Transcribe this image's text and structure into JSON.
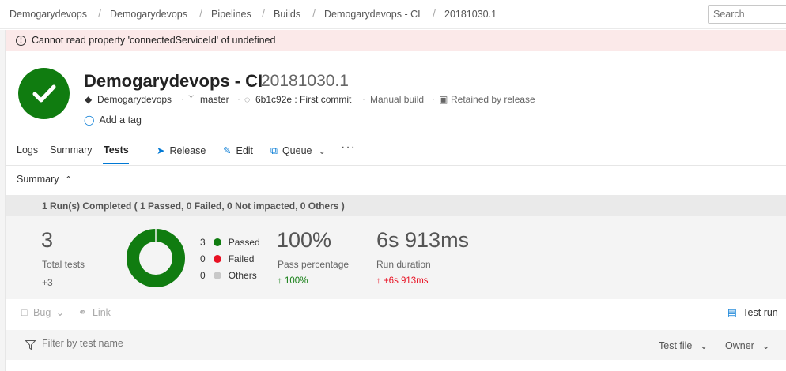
{
  "breadcrumb": [
    "Demogarydevops",
    "Demogarydevops",
    "Pipelines",
    "Builds",
    "Demogarydevops - CI",
    "20181030.1"
  ],
  "search": {
    "placeholder": "Search"
  },
  "error": {
    "message": "Cannot read property 'connectedServiceId' of undefined"
  },
  "build": {
    "title": "Demogarydevops - CI",
    "number": "20181030.1",
    "status": "succeeded",
    "status_color": "#107c10",
    "repo": "Demogarydevops",
    "branch": "master",
    "commit": "6b1c92e : First commit",
    "trigger": "Manual build",
    "retention": "Retained by release",
    "add_tag": "Add a tag"
  },
  "tabs": [
    {
      "label": "Logs",
      "active": false
    },
    {
      "label": "Summary",
      "active": false
    },
    {
      "label": "Tests",
      "active": true
    }
  ],
  "actions": {
    "release": "Release",
    "edit": "Edit",
    "queue": "Queue",
    "more": "···"
  },
  "summary": {
    "header": "Summary",
    "runs_text": "1 Run(s) Completed ( 1 Passed, 0 Failed, 0 Not impacted, 0 Others )",
    "total_tests": {
      "value": "3",
      "label": "Total tests",
      "delta": "+3"
    },
    "outcomes": [
      {
        "count": "3",
        "label": "Passed",
        "color": "#107c10"
      },
      {
        "count": "0",
        "label": "Failed",
        "color": "#e81123"
      },
      {
        "count": "0",
        "label": "Others",
        "color": "#c8c8c8"
      }
    ],
    "pass_percentage": {
      "value": "100%",
      "label": "Pass percentage",
      "delta": "100%",
      "delta_color": "#107c10"
    },
    "run_duration": {
      "value": "6s 913ms",
      "label": "Run duration",
      "delta": "+6s 913ms",
      "delta_color": "#e81123"
    }
  },
  "toolbar": {
    "bug": "Bug",
    "link": "Link",
    "test_run": "Test run"
  },
  "filter": {
    "placeholder": "Filter by test name",
    "test_file": "Test file",
    "owner": "Owner"
  }
}
